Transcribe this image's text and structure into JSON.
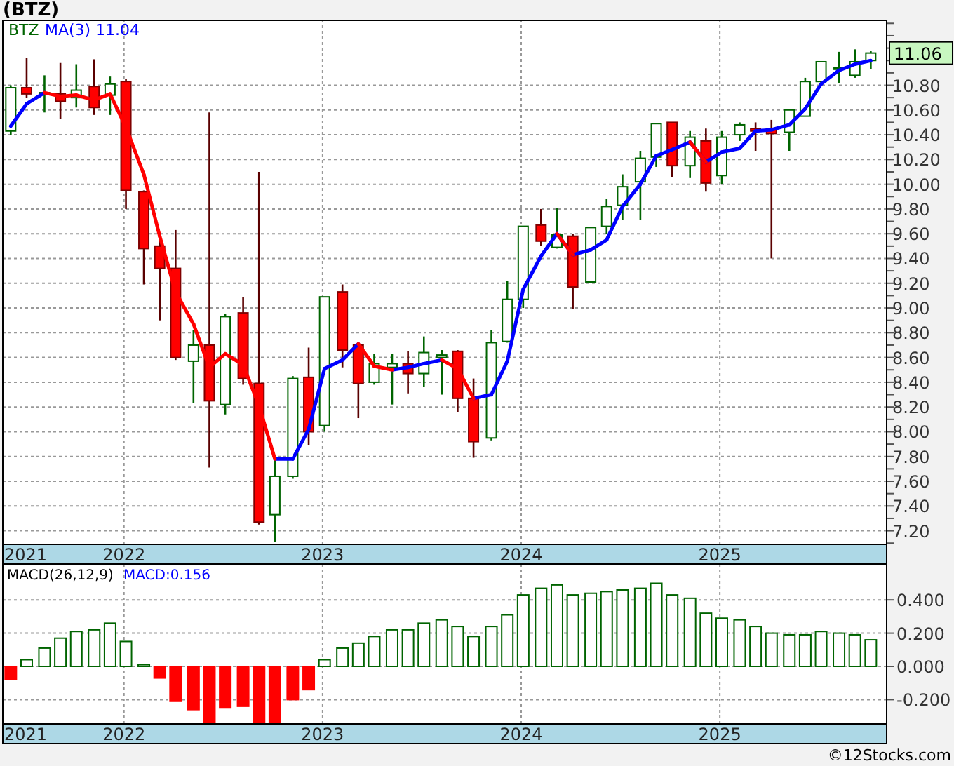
{
  "title": "(BTZ)",
  "price_panel": {
    "legend": {
      "symbol": "BTZ",
      "indicator_value": "11.04"
    },
    "last_price": "11.06",
    "start_label": "2021",
    "chart_data": {
      "type": "candlestick",
      "grid": true,
      "ylim": [
        7.09,
        11.33
      ],
      "xlim": [
        2021.39,
        2025.84
      ],
      "x": [
        2021.43,
        2021.51,
        2021.6,
        2021.68,
        2021.76,
        2021.85,
        2021.93,
        2022.01,
        2022.1,
        2022.18,
        2022.26,
        2022.35,
        2022.43,
        2022.51,
        2022.6,
        2022.68,
        2022.76,
        2022.85,
        2022.93,
        2023.01,
        2023.1,
        2023.18,
        2023.26,
        2023.35,
        2023.43,
        2023.51,
        2023.6,
        2023.68,
        2023.76,
        2023.85,
        2023.93,
        2024.01,
        2024.1,
        2024.18,
        2024.26,
        2024.35,
        2024.43,
        2024.51,
        2024.6,
        2024.68,
        2024.76,
        2024.85,
        2024.93,
        2025.01,
        2025.1,
        2025.18,
        2025.26,
        2025.35,
        2025.43,
        2025.51,
        2025.6,
        2025.68,
        2025.76
      ],
      "xticks": [
        {
          "value": 2022,
          "label": "2022"
        },
        {
          "value": 2023,
          "label": "2023"
        },
        {
          "value": 2024,
          "label": "2024"
        },
        {
          "value": 2025,
          "label": "2025"
        }
      ],
      "yticks": [
        {
          "value": 7.2,
          "label": "7.20"
        },
        {
          "value": 7.4,
          "label": "7.40"
        },
        {
          "value": 7.6,
          "label": "7.60"
        },
        {
          "value": 7.8,
          "label": "7.80"
        },
        {
          "value": 8.0,
          "label": "8.00"
        },
        {
          "value": 8.2,
          "label": "8.20"
        },
        {
          "value": 8.4,
          "label": "8.40"
        },
        {
          "value": 8.6,
          "label": "8.60"
        },
        {
          "value": 8.8,
          "label": "8.80"
        },
        {
          "value": 9.0,
          "label": "9.00"
        },
        {
          "value": 9.2,
          "label": "9.20"
        },
        {
          "value": 9.4,
          "label": "9.40"
        },
        {
          "value": 9.6,
          "label": "9.60"
        },
        {
          "value": 9.8,
          "label": "9.80"
        },
        {
          "value": 10.0,
          "label": "10.00"
        },
        {
          "value": 10.2,
          "label": "10.20"
        },
        {
          "value": 10.4,
          "label": "10.40"
        },
        {
          "value": 10.6,
          "label": "10.60"
        },
        {
          "value": 10.8,
          "label": "10.80"
        }
      ],
      "series": [
        {
          "name": "MA(3)",
          "type": "line",
          "color": "#0000ff",
          "values": [
            10.47,
            10.65,
            10.74,
            null,
            null,
            null,
            null,
            null,
            null,
            null,
            null,
            null,
            null,
            null,
            null,
            null,
            7.78,
            7.78,
            8.02,
            8.51,
            8.58,
            8.71,
            null,
            8.5,
            8.52,
            8.55,
            8.58,
            null,
            8.27,
            8.3,
            8.57,
            9.15,
            9.42,
            9.6,
            9.43,
            9.47,
            9.55,
            9.82,
            10.0,
            10.23,
            10.28,
            10.34,
            10.18,
            10.26,
            10.29,
            10.43,
            10.44,
            10.48,
            10.61,
            10.81,
            10.92,
            10.97,
            11.0
          ]
        },
        {
          "type": "line",
          "color": "#ff0000",
          "values": [
            null,
            null,
            10.74,
            10.71,
            10.72,
            10.68,
            10.73,
            10.46,
            10.08,
            9.58,
            9.13,
            8.87,
            8.52,
            8.63,
            8.54,
            8.21,
            7.78,
            null,
            null,
            null,
            null,
            8.71,
            8.53,
            8.5,
            null,
            null,
            8.58,
            8.51,
            8.27,
            null,
            null,
            null,
            null,
            9.6,
            9.43,
            null,
            null,
            null,
            null,
            null,
            null,
            10.34,
            10.18,
            null,
            null,
            null,
            null,
            null,
            null,
            null,
            null,
            null,
            null
          ]
        }
      ],
      "ohlc": [
        [
          10.43,
          10.8,
          10.4,
          10.78
        ],
        [
          10.78,
          11.02,
          10.7,
          10.73
        ],
        [
          10.74,
          10.88,
          10.58,
          10.74
        ],
        [
          10.73,
          10.98,
          10.53,
          10.67
        ],
        [
          10.7,
          10.97,
          10.62,
          10.76
        ],
        [
          10.79,
          11.01,
          10.56,
          10.62
        ],
        [
          10.72,
          10.87,
          10.56,
          10.81
        ],
        [
          10.83,
          10.85,
          9.8,
          9.95
        ],
        [
          9.94,
          9.95,
          9.19,
          9.48
        ],
        [
          9.5,
          9.55,
          8.9,
          9.32
        ],
        [
          9.32,
          9.63,
          8.58,
          8.6
        ],
        [
          8.57,
          8.82,
          8.23,
          8.7
        ],
        [
          8.7,
          10.58,
          7.71,
          8.25
        ],
        [
          8.22,
          8.95,
          8.14,
          8.93
        ],
        [
          8.96,
          9.09,
          8.38,
          8.43
        ],
        [
          8.39,
          10.1,
          7.25,
          7.27
        ],
        [
          7.33,
          7.79,
          7.11,
          7.64
        ],
        [
          7.64,
          8.45,
          7.62,
          8.43
        ],
        [
          8.44,
          8.68,
          7.89,
          8.0
        ],
        [
          8.05,
          9.09,
          8.0,
          9.09
        ],
        [
          9.13,
          9.19,
          8.52,
          8.66
        ],
        [
          8.7,
          8.7,
          8.11,
          8.39
        ],
        [
          8.4,
          8.63,
          8.38,
          8.55
        ],
        [
          8.52,
          8.63,
          8.22,
          8.55
        ],
        [
          8.55,
          8.65,
          8.31,
          8.47
        ],
        [
          8.47,
          8.77,
          8.36,
          8.64
        ],
        [
          8.6,
          8.66,
          8.3,
          8.62
        ],
        [
          8.65,
          8.66,
          8.16,
          8.27
        ],
        [
          8.27,
          8.43,
          7.79,
          7.92
        ],
        [
          7.95,
          8.82,
          7.93,
          8.72
        ],
        [
          8.73,
          9.22,
          8.72,
          9.07
        ],
        [
          9.07,
          9.66,
          9.0,
          9.66
        ],
        [
          9.67,
          9.8,
          9.5,
          9.54
        ],
        [
          9.49,
          9.81,
          9.48,
          9.59
        ],
        [
          9.58,
          9.6,
          8.99,
          9.17
        ],
        [
          9.21,
          9.65,
          9.2,
          9.65
        ],
        [
          9.66,
          9.88,
          9.6,
          9.82
        ],
        [
          9.83,
          10.08,
          9.71,
          9.98
        ],
        [
          10.02,
          10.27,
          9.71,
          10.21
        ],
        [
          10.22,
          10.49,
          10.14,
          10.49
        ],
        [
          10.5,
          10.5,
          10.06,
          10.15
        ],
        [
          10.15,
          10.43,
          10.05,
          10.38
        ],
        [
          10.35,
          10.45,
          9.94,
          10.01
        ],
        [
          10.07,
          10.43,
          10.0,
          10.38
        ],
        [
          10.4,
          10.5,
          10.35,
          10.48
        ],
        [
          10.45,
          10.5,
          10.27,
          10.43
        ],
        [
          10.45,
          10.52,
          9.4,
          10.41
        ],
        [
          10.42,
          10.6,
          10.27,
          10.6
        ],
        [
          10.55,
          10.86,
          10.55,
          10.83
        ],
        [
          10.83,
          10.99,
          10.83,
          10.99
        ],
        [
          10.94,
          11.07,
          10.82,
          10.94
        ],
        [
          10.88,
          11.09,
          10.86,
          10.99
        ],
        [
          11.0,
          11.08,
          10.93,
          11.06
        ]
      ]
    }
  },
  "macd_panel": {
    "legend": {
      "value": "MACD:0.156"
    },
    "start_label": "2021",
    "chart_data": {
      "type": "bar",
      "grid": true,
      "ylim": [
        -0.346,
        0.616
      ],
      "xlim": [
        2021.39,
        2025.84
      ],
      "x": [
        2021.43,
        2021.51,
        2021.6,
        2021.68,
        2021.76,
        2021.85,
        2021.93,
        2022.01,
        2022.1,
        2022.18,
        2022.26,
        2022.35,
        2022.43,
        2022.51,
        2022.6,
        2022.68,
        2022.76,
        2022.85,
        2022.93,
        2023.01,
        2023.1,
        2023.18,
        2023.26,
        2023.35,
        2023.43,
        2023.51,
        2023.6,
        2023.68,
        2023.76,
        2023.85,
        2023.93,
        2024.01,
        2024.1,
        2024.18,
        2024.26,
        2024.35,
        2024.43,
        2024.51,
        2024.6,
        2024.68,
        2024.76,
        2024.85,
        2024.93,
        2025.01,
        2025.1,
        2025.18,
        2025.26,
        2025.35,
        2025.43,
        2025.51,
        2025.6,
        2025.68,
        2025.76
      ],
      "xticks": [
        {
          "value": 2022,
          "label": "2022"
        },
        {
          "value": 2023,
          "label": "2023"
        },
        {
          "value": 2024,
          "label": "2024"
        },
        {
          "value": 2025,
          "label": "2025"
        }
      ],
      "yticks": [
        {
          "value": 0.4,
          "label": "0.400"
        },
        {
          "value": 0.2,
          "label": "0.200"
        },
        {
          "value": 0,
          "label": "0.000"
        },
        {
          "value": -0.2,
          "label": "-0.200"
        }
      ],
      "series": [
        {
          "name": "MACD(26,12,9)",
          "color": "#006400",
          "values": [
            null,
            0.04,
            0.11,
            0.17,
            0.21,
            0.22,
            0.26,
            0.15,
            0.01,
            null,
            null,
            null,
            null,
            null,
            null,
            null,
            null,
            null,
            null,
            0.04,
            0.11,
            0.14,
            0.18,
            0.22,
            0.22,
            0.26,
            0.28,
            0.24,
            0.18,
            0.24,
            0.31,
            0.43,
            0.47,
            0.49,
            0.43,
            0.44,
            0.45,
            0.46,
            0.47,
            0.5,
            0.43,
            0.41,
            0.32,
            0.29,
            0.28,
            0.24,
            0.2,
            0.19,
            0.19,
            0.21,
            0.2,
            0.19,
            0.16
          ]
        },
        {
          "color": "#ff0000",
          "values": [
            -0.08,
            null,
            null,
            null,
            null,
            null,
            null,
            null,
            null,
            -0.07,
            -0.21,
            -0.26,
            -0.34,
            -0.25,
            -0.24,
            -0.34,
            -0.34,
            -0.2,
            -0.14,
            null,
            null,
            null,
            null,
            null,
            null,
            null,
            null,
            null,
            null,
            null,
            null,
            null,
            null,
            null,
            null,
            null,
            null,
            null,
            null,
            null,
            null,
            null,
            null,
            null,
            null,
            null,
            null,
            null,
            null,
            null,
            null,
            null,
            null
          ]
        }
      ]
    }
  },
  "footer": "©12Stocks.com"
}
